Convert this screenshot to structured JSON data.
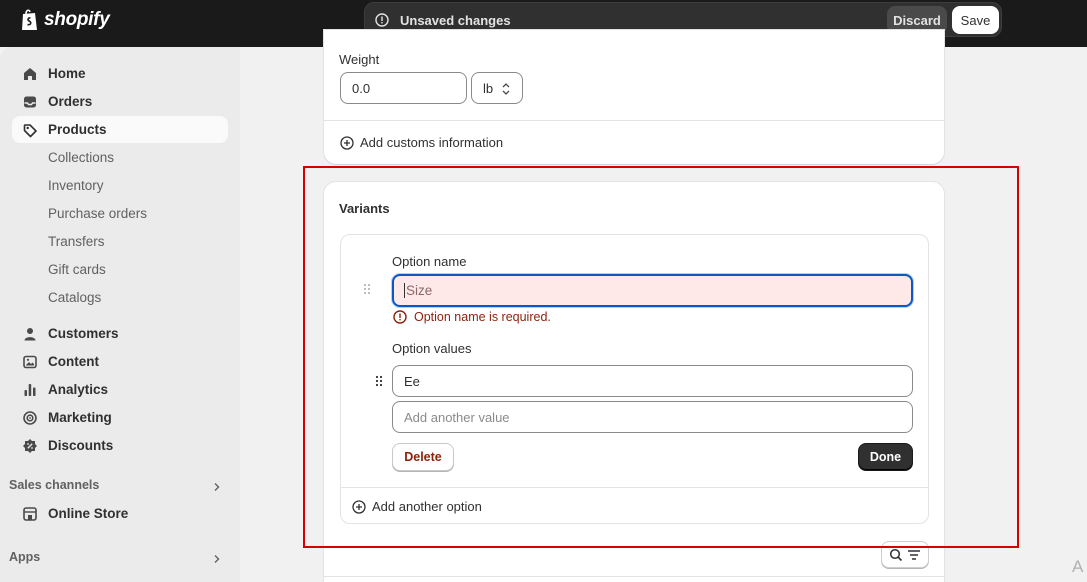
{
  "topbar": {
    "logo_text": "shopify",
    "savebar_message": "Unsaved changes",
    "discard_label": "Discard",
    "save_label": "Save"
  },
  "sidebar": {
    "main_items": [
      {
        "label": "Home",
        "icon": "home-icon"
      },
      {
        "label": "Orders",
        "icon": "orders-inbox-icon"
      },
      {
        "label": "Products",
        "icon": "tag-icon"
      }
    ],
    "product_subitems": [
      "Collections",
      "Inventory",
      "Purchase orders",
      "Transfers",
      "Gift cards",
      "Catalogs"
    ],
    "other_items": [
      {
        "label": "Customers",
        "icon": "person-icon"
      },
      {
        "label": "Content",
        "icon": "content-image-icon"
      },
      {
        "label": "Analytics",
        "icon": "bar-chart-icon"
      },
      {
        "label": "Marketing",
        "icon": "target-icon"
      },
      {
        "label": "Discounts",
        "icon": "discount-badge-icon"
      }
    ],
    "sales_channels_title": "Sales channels",
    "online_store_label": "Online Store",
    "apps_title": "Apps"
  },
  "shipping": {
    "weight_label": "Weight",
    "weight_value": "0.0",
    "unit_value": "lb",
    "customs_link": "Add customs information"
  },
  "variants": {
    "title": "Variants",
    "option_name_label": "Option name",
    "option_name_placeholder": "Size",
    "error_message": "Option name is required.",
    "option_values_label": "Option values",
    "value_1": "Ee",
    "add_value_placeholder": "Add another value",
    "delete_label": "Delete",
    "done_label": "Done",
    "add_option_link": "Add another option"
  },
  "colors": {
    "topbar": "#1a1a1a",
    "error": "#8e1f0b",
    "error_fill": "#fee9e8",
    "focus": "#0b57c4",
    "highlight": "#d60000"
  },
  "corner_glyph": "A"
}
